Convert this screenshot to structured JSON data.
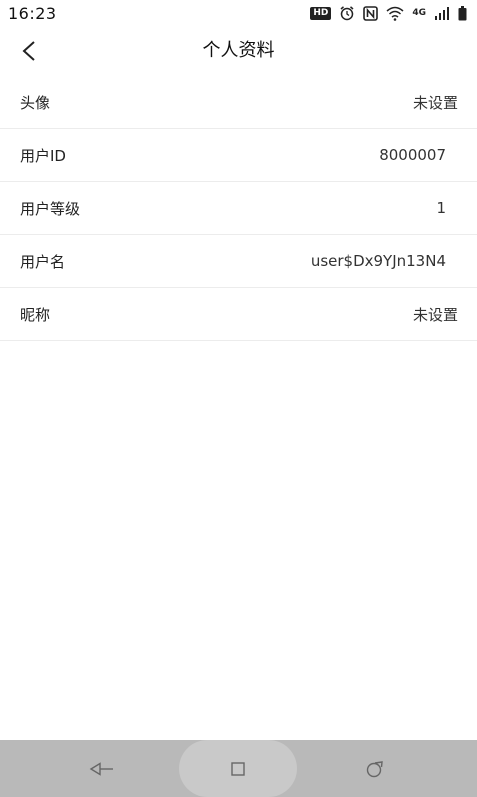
{
  "status_bar": {
    "time": "16:23",
    "hd_label": "HD",
    "network_label": "4G",
    "icons": [
      "hd-icon",
      "alarm-icon",
      "nfc-icon",
      "wifi-icon",
      "network-4g-icon",
      "signal-icon",
      "battery-icon"
    ]
  },
  "header": {
    "title": "个人资料",
    "back_icon": "chevron-left-icon"
  },
  "profile": {
    "rows": [
      {
        "label": "头像",
        "value": "未设置"
      },
      {
        "label": "用户ID",
        "value": "8000007"
      },
      {
        "label": "用户等级",
        "value": "1"
      },
      {
        "label": "用户名",
        "value": "user$Dx9YJn13N4"
      },
      {
        "label": "昵称",
        "value": "未设置"
      }
    ]
  },
  "nav_bar": {
    "icons": [
      "back-triangle-icon",
      "home-square-icon",
      "recent-apps-icon"
    ],
    "colors": {
      "background": "#b9b9b9",
      "pill": "#c9c9c9"
    }
  }
}
